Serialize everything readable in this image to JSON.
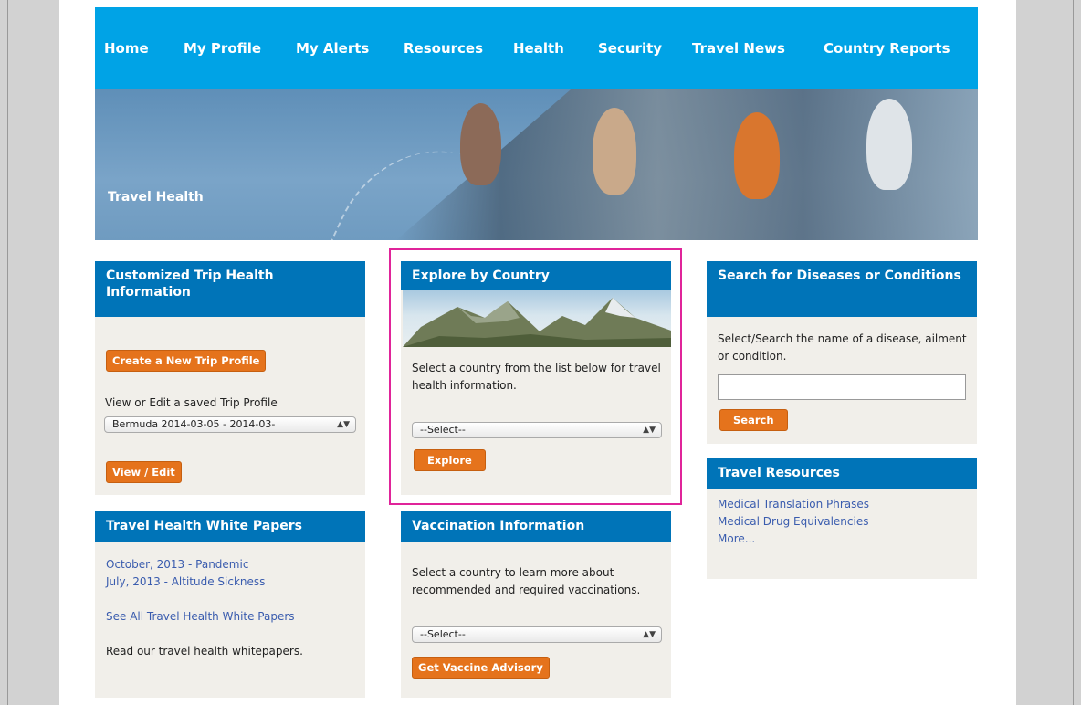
{
  "nav": {
    "items": [
      "Home",
      "My Profile",
      "My Alerts",
      "Resources",
      "Health",
      "Security",
      "Travel News",
      "Country Reports"
    ]
  },
  "banner": {
    "title": "Travel Health"
  },
  "trip_panel": {
    "title": "Customized Trip Health Information",
    "create_button": "Create a New Trip Profile",
    "saved_label": "View or Edit a saved Trip Profile",
    "saved_select": "Bermuda 2014-03-05 - 2014-03-",
    "view_button": "View / Edit"
  },
  "explore_panel": {
    "title": "Explore by Country",
    "description": "Select a country from the list below for travel health information.",
    "select_value": "--Select--",
    "button": "Explore"
  },
  "disease_panel": {
    "title": "Search for Diseases or Conditions",
    "description": "Select/Search the name of a disease, ailment or condition.",
    "input_value": "",
    "button": "Search"
  },
  "white_papers_panel": {
    "title": "Travel Health White Papers",
    "links": [
      "October, 2013 - Pandemic",
      "July, 2013 - Altitude Sickness"
    ],
    "see_all": "See All Travel Health White Papers",
    "footer": "Read our travel health whitepapers."
  },
  "vaccination_panel": {
    "title": "Vaccination Information",
    "description": "Select a country to learn more about recommended and required vaccinations.",
    "select_value": "--Select--",
    "button": "Get Vaccine Advisory"
  },
  "resources_panel": {
    "title": "Travel Resources",
    "links": [
      "Medical Translation Phrases",
      "Medical Drug Equivalencies",
      "More..."
    ]
  },
  "colors": {
    "nav": "#00a3e6",
    "panel_header": "#0074b8",
    "button": "#e5731c",
    "highlight": "#e0249a",
    "link": "#3a5cae"
  }
}
